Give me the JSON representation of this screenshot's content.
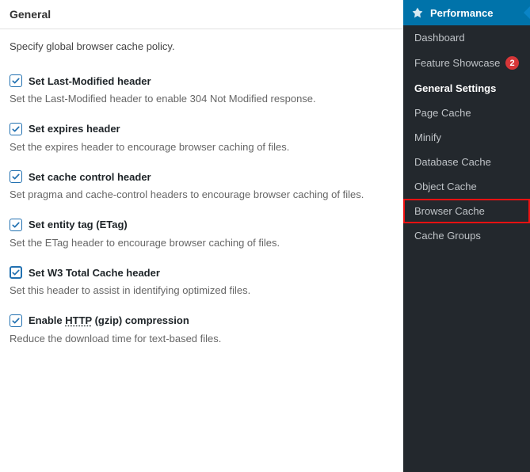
{
  "section": {
    "title": "General",
    "intro": "Specify global browser cache policy."
  },
  "options": [
    {
      "label_pre": "Set Last-Modified header",
      "label_abbr": "",
      "label_post": "",
      "desc": "Set the Last-Modified header to enable 304 Not Modified response.",
      "checked": true,
      "bold": false
    },
    {
      "label_pre": "Set expires header",
      "label_abbr": "",
      "label_post": "",
      "desc": "Set the expires header to encourage browser caching of files.",
      "checked": true,
      "bold": false
    },
    {
      "label_pre": "Set cache control header",
      "label_abbr": "",
      "label_post": "",
      "desc": "Set pragma and cache-control headers to encourage browser caching of files.",
      "checked": true,
      "bold": false
    },
    {
      "label_pre": "Set entity tag (ETag)",
      "label_abbr": "",
      "label_post": "",
      "desc": "Set the ETag header to encourage browser caching of files.",
      "checked": true,
      "bold": false
    },
    {
      "label_pre": "Set W3 Total Cache header",
      "label_abbr": "",
      "label_post": "",
      "desc": "Set this header to assist in identifying optimized files.",
      "checked": true,
      "bold": true
    },
    {
      "label_pre": "Enable ",
      "label_abbr": "HTTP",
      "label_post": " (gzip) compression",
      "desc": "Reduce the download time for text-based files.",
      "checked": true,
      "bold": false
    }
  ],
  "sidebar": {
    "header": "Performance",
    "items": [
      {
        "label": "Dashboard",
        "badge": "",
        "active": false,
        "highlighted": false
      },
      {
        "label": "Feature Showcase",
        "badge": "2",
        "active": false,
        "highlighted": false
      },
      {
        "label": "General Settings",
        "badge": "",
        "active": true,
        "highlighted": false
      },
      {
        "label": "Page Cache",
        "badge": "",
        "active": false,
        "highlighted": false
      },
      {
        "label": "Minify",
        "badge": "",
        "active": false,
        "highlighted": false
      },
      {
        "label": "Database Cache",
        "badge": "",
        "active": false,
        "highlighted": false
      },
      {
        "label": "Object Cache",
        "badge": "",
        "active": false,
        "highlighted": false
      },
      {
        "label": "Browser Cache",
        "badge": "",
        "active": false,
        "highlighted": true
      },
      {
        "label": "Cache Groups",
        "badge": "",
        "active": false,
        "highlighted": false
      }
    ]
  }
}
